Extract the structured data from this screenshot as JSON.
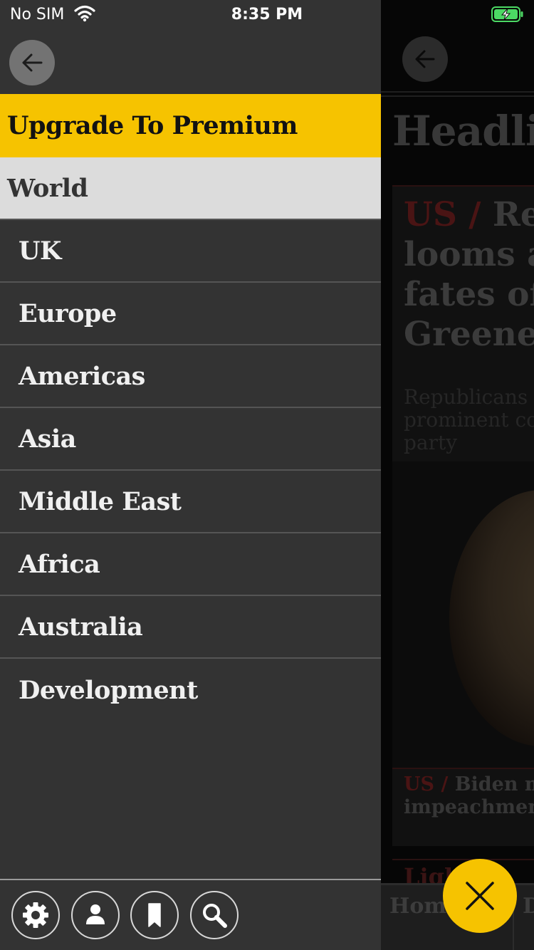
{
  "status_bar": {
    "carrier": "No SIM",
    "time": "8:35 PM",
    "wifi_icon": "wifi-icon",
    "battery_icon": "battery-charging-icon",
    "battery_color": "#4cd964"
  },
  "drawer": {
    "back_icon": "arrow-left-icon",
    "premium_label": "Upgrade To Premium",
    "section_header": "World",
    "items": [
      {
        "label": "UK"
      },
      {
        "label": "Europe"
      },
      {
        "label": "Americas"
      },
      {
        "label": "Asia"
      },
      {
        "label": "Middle East"
      },
      {
        "label": "Africa"
      },
      {
        "label": "Australia"
      },
      {
        "label": "Development"
      }
    ],
    "footer_icons": [
      "gear-icon",
      "profile-icon",
      "bookmark-icon",
      "search-icon"
    ]
  },
  "background": {
    "section_title": "Headlin",
    "lead": {
      "kicker": "US /",
      "headline": "Rep\nlooms as\nfates of r\nGreene",
      "standfirst": "Republicans r\nprominent cor\nparty"
    },
    "second": {
      "kicker": "US /",
      "headline": "Biden mov\nimpeachment"
    },
    "third": {
      "text": "Ligh        US"
    },
    "tabs": [
      {
        "label": "Home"
      },
      {
        "label": "D"
      }
    ]
  },
  "close_icon": "close-icon",
  "colors": {
    "accent_yellow": "#f6c300",
    "drawer_bg": "#333333",
    "header_bg": "#dcdcdc"
  }
}
